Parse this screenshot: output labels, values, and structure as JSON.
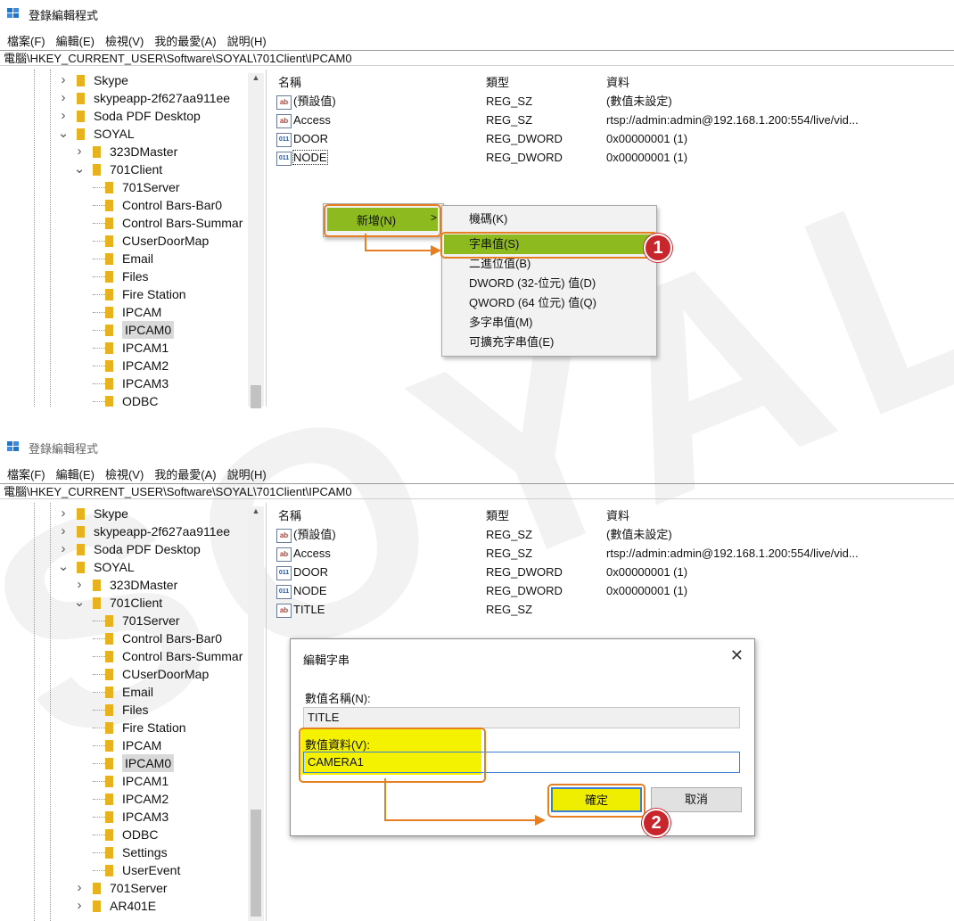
{
  "app": {
    "title": "登錄編輯程式"
  },
  "menu": [
    "檔案(F)",
    "編輯(E)",
    "檢視(V)",
    "我的最愛(A)",
    "說明(H)"
  ],
  "address": "電腦\\HKEY_CURRENT_USER\\Software\\SOYAL\\701Client\\IPCAM0",
  "watermark": "SOYAL",
  "columns": {
    "name": "名稱",
    "type": "類型",
    "data": "資料"
  },
  "tree_top": [
    "Skype",
    "skypeapp-2f627aa911ee",
    "Soda PDF Desktop",
    "SOYAL",
    "323DMaster",
    "701Client",
    "701Server",
    "Control Bars-Bar0",
    "Control Bars-Summar",
    "CUserDoorMap",
    "Email",
    "Files",
    "Fire Station",
    "IPCAM",
    "IPCAM0",
    "IPCAM1",
    "IPCAM2",
    "IPCAM3",
    "ODBC"
  ],
  "tree_bottom": [
    "Skype",
    "skypeapp-2f627aa911ee",
    "Soda PDF Desktop",
    "SOYAL",
    "323DMaster",
    "701Client",
    "701Server",
    "Control Bars-Bar0",
    "Control Bars-Summar",
    "CUserDoorMap",
    "Email",
    "Files",
    "Fire Station",
    "IPCAM",
    "IPCAM0",
    "IPCAM1",
    "IPCAM2",
    "IPCAM3",
    "ODBC",
    "Settings",
    "UserEvent",
    "701Server",
    "AR401E"
  ],
  "values_top": [
    {
      "icon": "ab",
      "name": "(預設值)",
      "type": "REG_SZ",
      "data": "(數值未設定)"
    },
    {
      "icon": "ab",
      "name": "Access",
      "type": "REG_SZ",
      "data": "rtsp://admin:admin@192.168.1.200:554/live/vid..."
    },
    {
      "icon": "dw",
      "name": "DOOR",
      "type": "REG_DWORD",
      "data": "0x00000001 (1)"
    },
    {
      "icon": "dw",
      "name": "NODE",
      "type": "REG_DWORD",
      "data": "0x00000001 (1)"
    }
  ],
  "values_bottom": [
    {
      "icon": "ab",
      "name": "(預設值)",
      "type": "REG_SZ",
      "data": "(數值未設定)"
    },
    {
      "icon": "ab",
      "name": "Access",
      "type": "REG_SZ",
      "data": "rtsp://admin:admin@192.168.1.200:554/live/vid..."
    },
    {
      "icon": "dw",
      "name": "DOOR",
      "type": "REG_DWORD",
      "data": "0x00000001 (1)"
    },
    {
      "icon": "dw",
      "name": "NODE",
      "type": "REG_DWORD",
      "data": "0x00000001 (1)"
    },
    {
      "icon": "ab",
      "name": "TITLE",
      "type": "REG_SZ",
      "data": ""
    }
  ],
  "context_menu": {
    "new_label": "新增(N)",
    "submenu_arrow": ">",
    "items": [
      "機碼(K)",
      "字串值(S)",
      "二進位值(B)",
      "DWORD (32-位元) 值(D)",
      "QWORD (64 位元) 值(Q)",
      "多字串值(M)",
      "可擴充字串值(E)"
    ]
  },
  "dialog": {
    "title": "編輯字串",
    "close": "✕",
    "name_label": "數值名稱(N):",
    "name_value": "TITLE",
    "data_label": "數值資料(V):",
    "data_value": "CAMERA1",
    "ok": "確定",
    "cancel": "取消"
  },
  "badges": [
    "1",
    "2"
  ],
  "colors": {
    "highlight_green": "#8dba1f",
    "highlight_yellow": "#f5f200",
    "annotation_orange": "#e67e22",
    "badge_red": "#c9252c"
  }
}
